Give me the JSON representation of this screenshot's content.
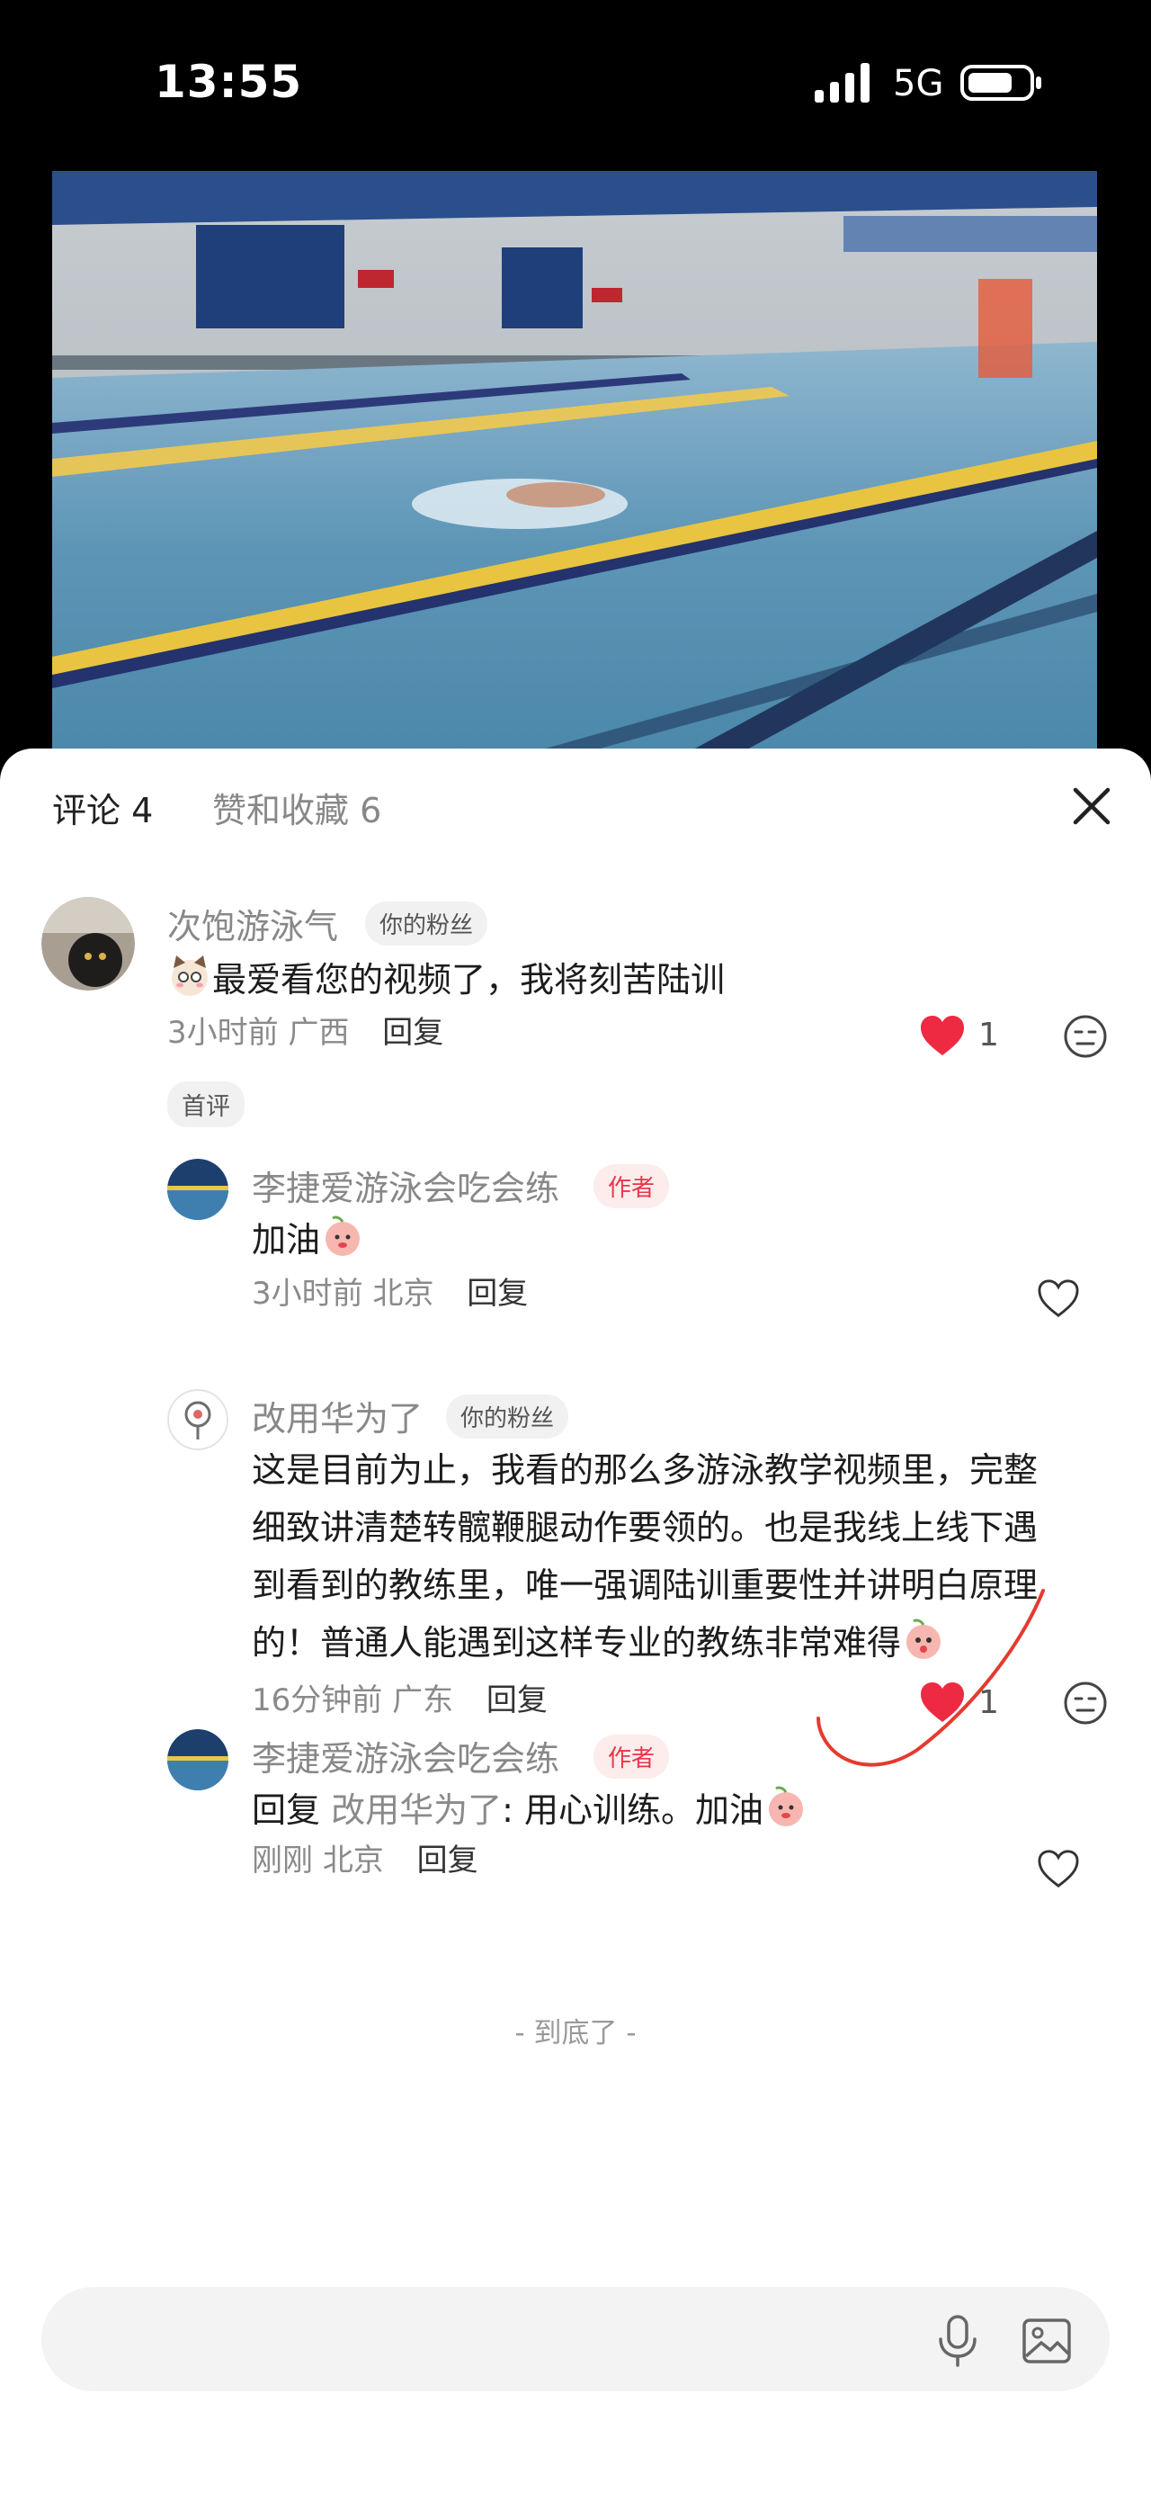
{
  "status_bar": {
    "time": "13:55",
    "network": "5G"
  },
  "tabs": {
    "comments": "评论 4",
    "likes": "赞和收藏 6"
  },
  "comments": [
    {
      "user": "次饱游泳气",
      "badge": "你的粉丝",
      "text": "最爱看您的视频了，我将刻苦陆训",
      "time": "3小时前",
      "location": "广西",
      "reply_label": "回复",
      "likes": "1",
      "first_comment_tag": "首评",
      "replies": [
        {
          "user": "李捷爱游泳会吃会练",
          "badge": "作者",
          "text": "加油",
          "time": "3小时前",
          "location": "北京",
          "reply_label": "回复"
        },
        {
          "user": "改用华为了",
          "badge": "你的粉丝",
          "text_lines": [
            "这是目前为止，我看的那么多游泳教学视频里，完整",
            "细致讲清楚转髋鞭腿动作要领的。也是我线上线下遇",
            "到看到的教练里，唯一强调陆训重要性并讲明白原理",
            "的！普通人能遇到这样专业的教练非常难得"
          ],
          "time": "16分钟前",
          "location": "广东",
          "reply_label": "回复",
          "likes": "1"
        },
        {
          "user": "李捷爱游泳会吃会练",
          "badge": "作者",
          "reply_prefix": "回复",
          "reply_to": "改用华为了",
          "text": ": 用心训练。加油",
          "time": "刚刚",
          "location": "北京",
          "reply_label": "回复"
        }
      ]
    }
  ],
  "end_hint": "- 到底了 -",
  "colors": {
    "accent_red": "#ee2a43",
    "author_badge": "#e8364a"
  },
  "icons": [
    "close-icon",
    "heart-filled-icon",
    "heart-outline-icon",
    "dislike-face-icon",
    "microphone-icon",
    "image-icon"
  ]
}
